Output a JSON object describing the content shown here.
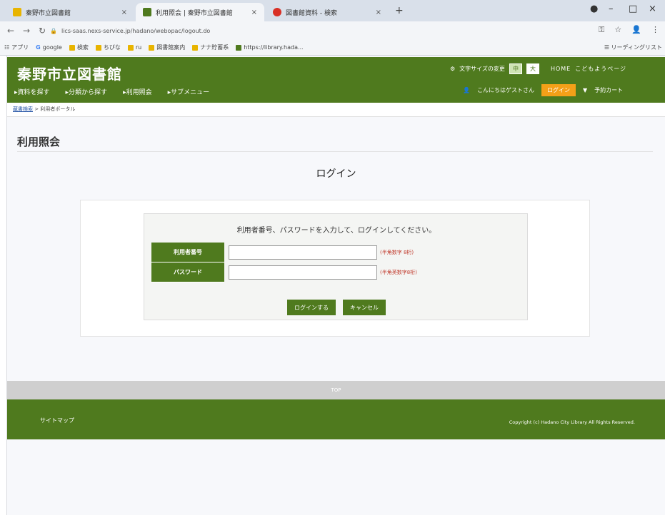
{
  "browser": {
    "tabs": [
      {
        "title": "秦野市立図書館",
        "close": "×",
        "color": "#e8b400"
      },
      {
        "title": "利用照会 | 秦野市立図書館",
        "close": "×",
        "color": "#4f7a1e"
      },
      {
        "title": "図書館資料 - 検索",
        "close": "×",
        "color": "#d93025"
      }
    ],
    "new_tab": "+",
    "window_controls": [
      "●",
      "–",
      "□",
      "×"
    ],
    "url": "lics-saas.nexs-service.jp/hadano/webopac/logout.do",
    "bookmarks": [
      "アプリ",
      "google",
      "検索",
      "ちびな",
      "ru",
      "図書館案内",
      "ナナ貯蓄系",
      "https://library.hada..."
    ],
    "bookmarks_right": "リーディングリスト"
  },
  "header": {
    "logo": "秦野市立図書館",
    "nav": [
      "▸資料を探す",
      "▸分類から探す",
      "▸利用照会",
      "▸サブメニュー"
    ],
    "font_size_label": "文字サイズの変更",
    "font_small": "中",
    "font_large": "大",
    "home": "HOME",
    "kids": "こどもようページ",
    "greeting": "こんにちはゲストさん",
    "login_button": "ログイン",
    "cart": "予約カート"
  },
  "breadcrumb": {
    "home": "蔵書検索",
    "sep": " > ",
    "current": "利用者ポータル"
  },
  "main": {
    "page_title": "利用照会",
    "login_heading": "ログイン",
    "instruction": "利用者番号、パスワードを入力して、ログインしてください。",
    "fields": [
      {
        "label": "利用者番号",
        "value": "",
        "hint": "(半角数字 8桁)"
      },
      {
        "label": "パスワード",
        "value": "",
        "hint": "(半角英数字8桁)"
      }
    ],
    "login_submit": "ログインする",
    "cancel": "キャンセル"
  },
  "footer": {
    "top_link": "TOP",
    "sitemap": "サイトマップ",
    "copyright": "Copyright (c) Hadano City Library All Rights Reserved."
  },
  "colors": {
    "brand_green": "#4f7a1e",
    "login_orange": "#f4a018"
  }
}
